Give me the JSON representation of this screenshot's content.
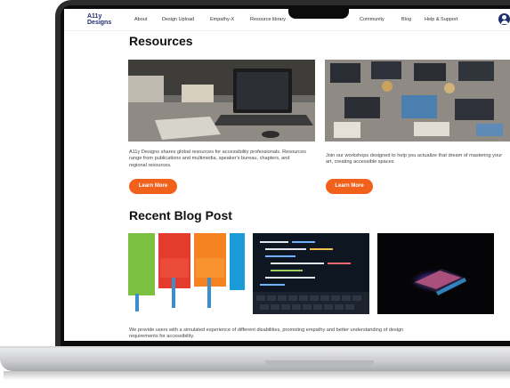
{
  "nav": {
    "logo_line1": "A11y",
    "logo_line2": "Designs",
    "links": [
      "About",
      "Design Upload",
      "Empathy-X",
      "Resource library",
      "Community",
      "Blog",
      "Help & Support"
    ]
  },
  "resources": {
    "title": "Resources",
    "cards": [
      {
        "description": "A11y Designs shares global resources for accessibility professionals. Resources range from publications and multimedia, speaker's bureau, chapters, and regional resources.",
        "button": "Learn More"
      },
      {
        "description": "Join our workshops designed to help you actualize that dream of mastering your art, creating accessible spaces",
        "button": "Learn More"
      }
    ]
  },
  "blog": {
    "title": "Recent Blog Post",
    "description": "We provide users with a simulated experience of different disabilities, promoting empathy and better understanding of design requirements for accessibility."
  },
  "colors": {
    "accent": "#f2611c",
    "brand": "#1d2f6e"
  }
}
